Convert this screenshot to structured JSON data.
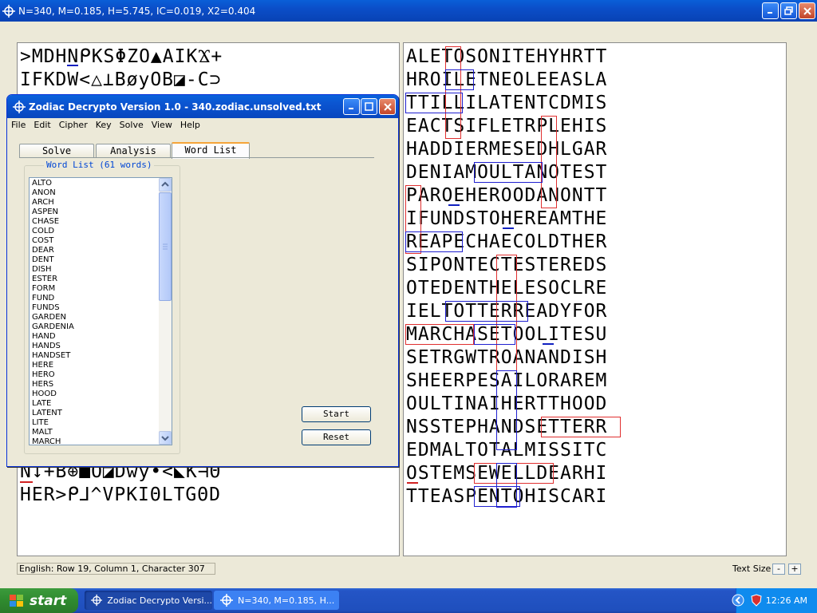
{
  "window": {
    "title": "N=340, M=0.185, H=5.745, IC=0.019, X2=0.404",
    "icon": "crosshair-icon"
  },
  "cipher_rows": [
    ">MDHNᑭKSΦZO▲AIKϪ+",
    "IFKDW<△⊥BøyOB◪-C⊃",
    "N↓+B⊕■O◪Dwy•<◣K⊣Θ",
    "HER>ᑭ⅃^VPKIΘLTGΘD"
  ],
  "plain_rows": [
    "ALETOSONITEHYHRTT",
    "HROILETNEOLEEASLA",
    "TTILLILATENTCDMIS",
    "EACTSIFLETRPLEHIS",
    "HADDIERMESEDHLGAR",
    "DENIAMOULTANOTEST",
    "PAROEHEROODANONTT",
    "IFUNDSTOHEREAMTHE",
    "REAPECHAECOLDTHER",
    "SIPONTECTESTEREDS",
    "OTEDENTHELESOCLRE",
    "IELTOTTERREADYFOR",
    "MARCHASETOOLITESU",
    "SETRGWTROANANDISH",
    "SHEERPESAILORAREM",
    "OULTINAIHERTTHOOD",
    "NSSTEPHANDSETTERR",
    "EDMALTOTALMISSITC",
    "OSTEMSEWELLDEARHI",
    "TTEASPENTOHISCARI"
  ],
  "status": {
    "text": "English: Row 19, Column 1, Character 307",
    "text_size_label": "Text Size",
    "minus": "-",
    "plus": "+"
  },
  "dialog": {
    "title": "Zodiac Decrypto Version 1.0 - 340.zodiac.unsolved.txt",
    "menu": [
      "File",
      "Edit",
      "Cipher",
      "Key",
      "Solve",
      "View",
      "Help"
    ],
    "tabs": [
      "Solve",
      "Analysis",
      "Word List"
    ],
    "active_tab": "Word List",
    "group_label": "Word List (61 words)",
    "words": [
      "ALTO",
      "ANON",
      "ARCH",
      "ASPEN",
      "CHASE",
      "COLD",
      "COST",
      "DEAR",
      "DENT",
      "DISH",
      "ESTER",
      "FORM",
      "FUND",
      "FUNDS",
      "GARDEN",
      "GARDENIA",
      "HAND",
      "HANDS",
      "HANDSET",
      "HERE",
      "HERO",
      "HERS",
      "HOOD",
      "LATE",
      "LATENT",
      "LITE",
      "MALT",
      "MARCH"
    ],
    "start_label": "Start",
    "reset_label": "Reset"
  },
  "taskbar": {
    "start_label": "start",
    "tasks": [
      "Zodiac Decrypto Versi...",
      "N=340, M=0.185, H..."
    ],
    "clock": "12:26 AM"
  },
  "colors": {
    "title_blue": "#0b4ec8",
    "box_red": "#e03030",
    "box_blue": "#2020d0",
    "tab_accent": "#f5a43a",
    "start_green": "#2f8a2f"
  }
}
